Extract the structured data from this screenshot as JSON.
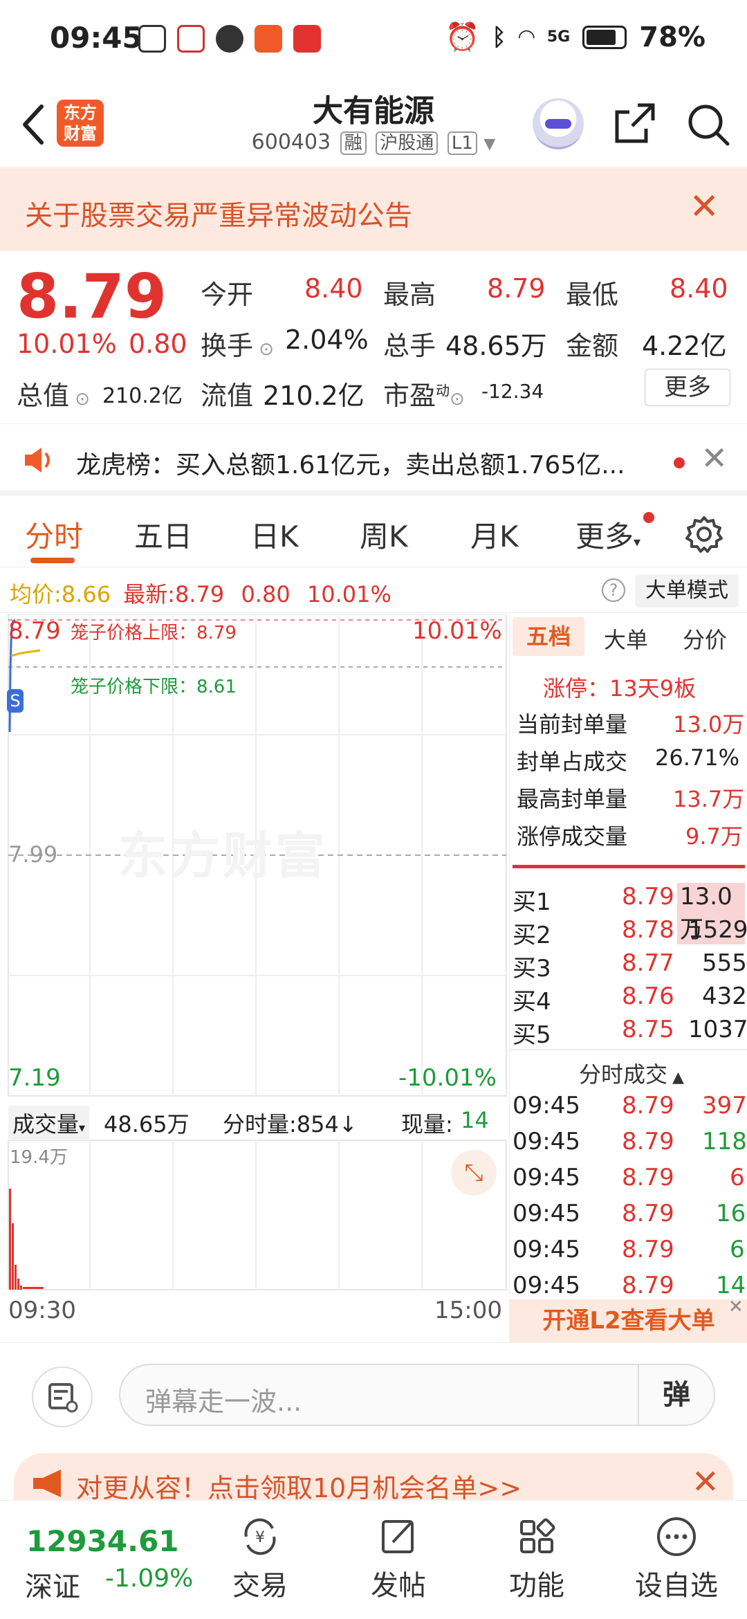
{
  "status_bar": {
    "time": "09:45",
    "network": "5G",
    "battery": "78%"
  },
  "header": {
    "back_label": "<",
    "app_logo": "东方财富",
    "stock_name": "大有能源",
    "stock_code": "600403",
    "tags": [
      "融",
      "沪股通",
      "L1"
    ]
  },
  "notice": {
    "text": "关于股票交易严重异常波动公告"
  },
  "quote": {
    "price": "8.79",
    "pct": "10.01%",
    "change": "0.80",
    "fields": [
      {
        "k": "今开",
        "v": "8.40",
        "color": "red"
      },
      {
        "k": "最高",
        "v": "8.79",
        "color": "red"
      },
      {
        "k": "最低",
        "v": "8.40",
        "color": "red"
      },
      {
        "k": "换手",
        "v": "2.04%",
        "color": "black"
      },
      {
        "k": "总手",
        "v": "48.65万",
        "color": "black"
      },
      {
        "k": "金额",
        "v": "4.22亿",
        "color": "black"
      },
      {
        "k": "总值",
        "v": "210.2亿",
        "color": "black"
      },
      {
        "k": "流值",
        "v": "210.2亿",
        "color": "black"
      },
      {
        "k": "市盈",
        "v": "-12.34",
        "color": "black"
      }
    ],
    "pe_superscript": "动",
    "more_label": "更多"
  },
  "dragon": {
    "text": "龙虎榜：买入总额1.61亿元，卖出总额1.765亿..."
  },
  "tabs": [
    "分时",
    "五日",
    "日K",
    "周K",
    "月K",
    "更多"
  ],
  "infobar": {
    "avg_label": "均价:",
    "avg_value": "8.66",
    "latest_label": "最新:",
    "latest_value": "8.79",
    "latest_change": "0.80",
    "latest_pct": "10.01%",
    "mode_button": "大单模式"
  },
  "chart": {
    "top_price": "8.79",
    "top_pct": "10.01%",
    "mid_price": "7.99",
    "bottom_price": "7.19",
    "bottom_pct": "-10.01%",
    "upper_limit_label": "笼子价格上限：8.79",
    "lower_limit_label": "笼子价格下限：8.61",
    "watermark": "东方财富",
    "volume_label": "成交量",
    "volume_value": "48.65万",
    "timeshare_vol": "分时量:854↓",
    "current_vol_label": "现量:",
    "current_vol_value": "14",
    "vol_axis_max": "19.4万",
    "time_start": "09:30",
    "time_end": "15:00"
  },
  "right_panel": {
    "tabs": [
      "五档",
      "大单",
      "分价"
    ],
    "limit_up": "涨停：13天9板",
    "stats": [
      {
        "k": "当前封单量",
        "v": "13.0万",
        "color": "red"
      },
      {
        "k": "封单占成交",
        "v": "26.71%",
        "color": "black"
      },
      {
        "k": "最高封单量",
        "v": "13.7万",
        "color": "red"
      },
      {
        "k": "涨停成交量",
        "v": "9.7万",
        "color": "red"
      }
    ],
    "bids": [
      {
        "label": "买1",
        "price": "8.79",
        "vol": "13.0万"
      },
      {
        "label": "买2",
        "price": "8.78",
        "vol": "1529"
      },
      {
        "label": "买3",
        "price": "8.77",
        "vol": "555"
      },
      {
        "label": "买4",
        "price": "8.76",
        "vol": "432"
      },
      {
        "label": "买5",
        "price": "8.75",
        "vol": "1037"
      }
    ],
    "ticks_title": "分时成交",
    "ticks": [
      {
        "time": "09:45",
        "price": "8.79",
        "vol": "397"
      },
      {
        "time": "09:45",
        "price": "8.79",
        "vol": "118"
      },
      {
        "time": "09:45",
        "price": "8.79",
        "vol": "6"
      },
      {
        "time": "09:45",
        "price": "8.79",
        "vol": "16"
      },
      {
        "time": "09:45",
        "price": "8.79",
        "vol": "6"
      },
      {
        "time": "09:45",
        "price": "8.79",
        "vol": "14"
      }
    ],
    "l2_button": "开通L2查看大单"
  },
  "danmu": {
    "placeholder": "弹幕走一波...",
    "send": "弹"
  },
  "promo": {
    "text": "对更从容！点击领取10月机会名单>>"
  },
  "bottom": {
    "index_value": "12934.61",
    "index_name": "深证",
    "index_pct": "-1.09%",
    "nav": [
      "交易",
      "发帖",
      "功能",
      "设自选"
    ]
  }
}
